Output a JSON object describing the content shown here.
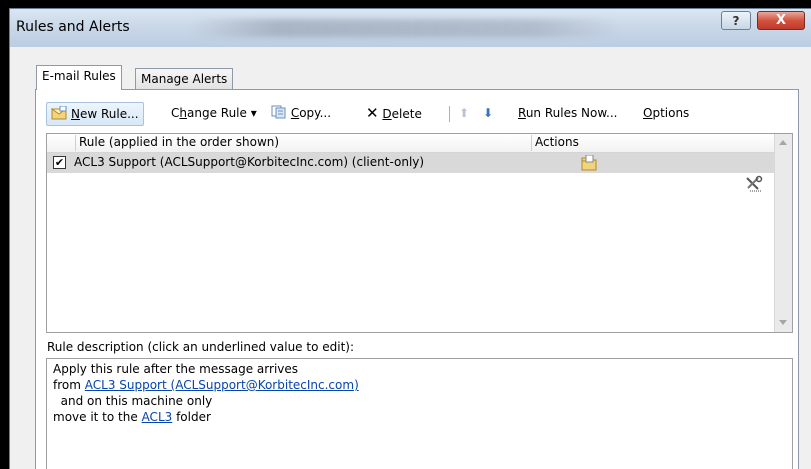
{
  "window": {
    "title": "Rules and Alerts",
    "help_label": "?",
    "close_label": "X"
  },
  "tabs": [
    {
      "label": "E-mail Rules",
      "active": true
    },
    {
      "label": "Manage Alerts",
      "active": false
    }
  ],
  "toolbar": {
    "new_rule": {
      "ul": "N",
      "rest": "ew Rule..."
    },
    "change_rule": {
      "pre": "C",
      "ul": "h",
      "rest": "ange Rule",
      "arrow": "▾"
    },
    "copy": {
      "ul": "C",
      "rest": "opy..."
    },
    "delete_icon": "✕",
    "delete": {
      "ul": "D",
      "rest": "elete"
    },
    "move_up_icon": "⬆",
    "move_down_icon": "⬇",
    "run_rules": {
      "ul": "R",
      "rest": "un Rules Now..."
    },
    "options": {
      "ul": "O",
      "rest": "ptions"
    }
  },
  "rules_table": {
    "columns": [
      "Rule (applied in the order shown)",
      "Actions"
    ],
    "rows": [
      {
        "checked": true,
        "check_glyph": "✔",
        "name": "ACL3 Support (ACLSupport@KorbitecInc.com)  (client-only)",
        "action_icon": "move-to-folder-icon"
      }
    ]
  },
  "description": {
    "label": "Rule description (click an underlined value to edit):",
    "line1": "Apply this rule after the message arrives",
    "line2_prefix": "from ",
    "line2_link": "ACL3 Support (ACLSupport@KorbitecInc.com)",
    "line3": "  and on this machine only",
    "line4_prefix": "move it to the ",
    "line4_link": "ACL3",
    "line4_suffix": " folder"
  },
  "colors": {
    "selected_row": "#d9d9d9",
    "link": "#0645ad",
    "close_button": "#c0392b"
  }
}
